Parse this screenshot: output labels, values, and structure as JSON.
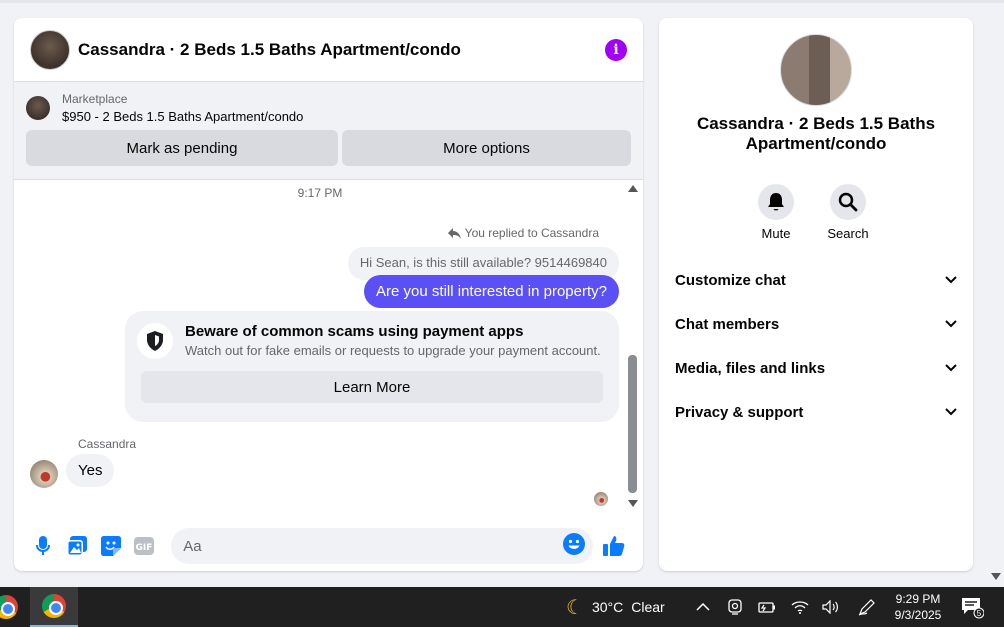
{
  "chat": {
    "title": "Cassandra · 2 Beds 1.5 Baths Apartment/condo",
    "marketplace_label": "Marketplace",
    "listing": "$950 - 2 Beds 1.5 Baths Apartment/condo",
    "mark_pending": "Mark as pending",
    "more_options": "More options",
    "timestamp": "9:17 PM",
    "replied_label": "You replied to Cassandra",
    "quoted_message": "Hi Sean, is this still available? 9514469840",
    "sent_message": "Are you still interested in property?",
    "scam_title": "Beware of common scams using payment apps",
    "scam_desc": "Watch out for fake emails or requests to upgrade your payment account.",
    "learn_more": "Learn More",
    "sender_name": "Cassandra",
    "received_message": "Yes",
    "input_placeholder": "Aa"
  },
  "info_panel": {
    "name": "Cassandra · 2 Beds 1.5 Baths Apartment/condo",
    "mute_label": "Mute",
    "search_label": "Search",
    "sections": [
      "Customize chat",
      "Chat members",
      "Media, files and links",
      "Privacy & support"
    ]
  },
  "taskbar": {
    "temperature": "30°C",
    "weather": "Clear",
    "time": "9:29 PM",
    "date": "9/3/2025",
    "notification_count": "5"
  },
  "colors": {
    "accent": "#5b50f6",
    "icon_blue": "#0a7cff",
    "info_purple": "#a100f2"
  },
  "icons": [
    "info-icon",
    "microphone-icon",
    "image-icon",
    "sticker-icon",
    "gif-icon",
    "emoji-icon",
    "thumbs-up-icon",
    "bell-icon",
    "search-icon",
    "chevron-down-icon",
    "shield-icon",
    "reply-icon"
  ]
}
